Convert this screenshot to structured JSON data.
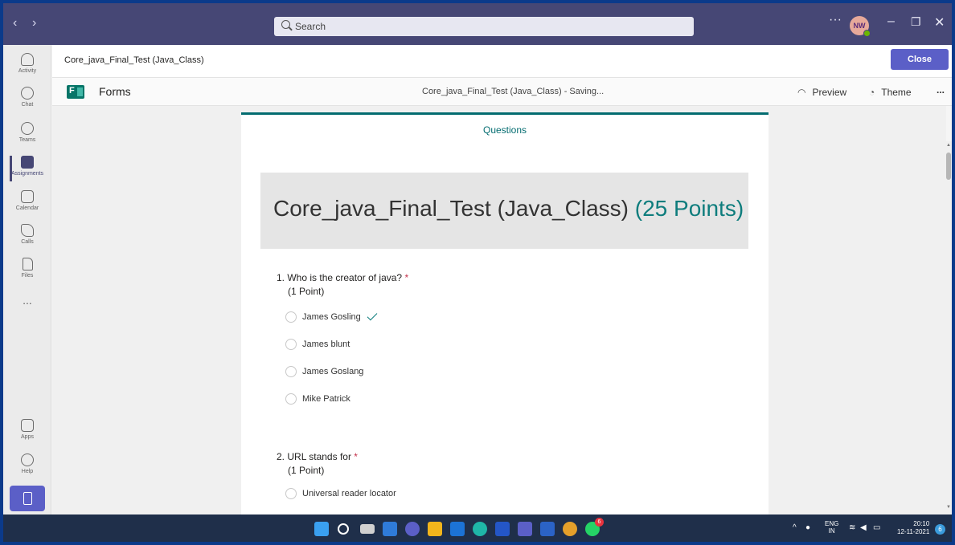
{
  "window": {
    "search_placeholder": "Search",
    "avatar_initials": "NW"
  },
  "rail": {
    "items": [
      {
        "label": "Activity",
        "icon": "bell-icon"
      },
      {
        "label": "Chat",
        "icon": "chat-icon"
      },
      {
        "label": "Teams",
        "icon": "teams-icon"
      },
      {
        "label": "Assignments",
        "icon": "assignments-icon",
        "active": true
      },
      {
        "label": "Calendar",
        "icon": "calendar-icon"
      },
      {
        "label": "Calls",
        "icon": "phone-icon"
      },
      {
        "label": "Files",
        "icon": "file-icon"
      }
    ],
    "more": "...",
    "apps_label": "Apps",
    "help_label": "Help"
  },
  "tabhead": {
    "title": "Core_java_Final_Test (Java_Class)",
    "close_label": "Close"
  },
  "formshead": {
    "app_name": "Forms",
    "status": "Core_java_Final_Test (Java_Class) - Saving...",
    "preview_label": "Preview",
    "theme_label": "Theme",
    "more": "..."
  },
  "form": {
    "tab_label": "Questions",
    "title": "Core_java_Final_Test (Java_Class)",
    "points": "(25 Points)",
    "questions": [
      {
        "number": "1.",
        "text": "Who is the creator of java?",
        "required": "*",
        "points": "(1 Point)",
        "options": [
          "James Gosling",
          "James blunt",
          "James Goslang",
          "Mike Patrick"
        ],
        "correct_index": 0
      },
      {
        "number": "2.",
        "text": "URL stands for",
        "required": "*",
        "points": "(1 Point)",
        "options": [
          "Universal reader locator"
        ]
      }
    ]
  },
  "taskbar": {
    "lang_top": "ENG",
    "lang_bottom": "IN",
    "time": "20:10",
    "date": "12-11-2021",
    "whatsapp_badge": "6",
    "notifications": "6"
  },
  "colors": {
    "teams_purple": "#464775",
    "forms_teal": "#036c70",
    "close_button": "#5b5fc7",
    "required_red": "#c4314b"
  }
}
